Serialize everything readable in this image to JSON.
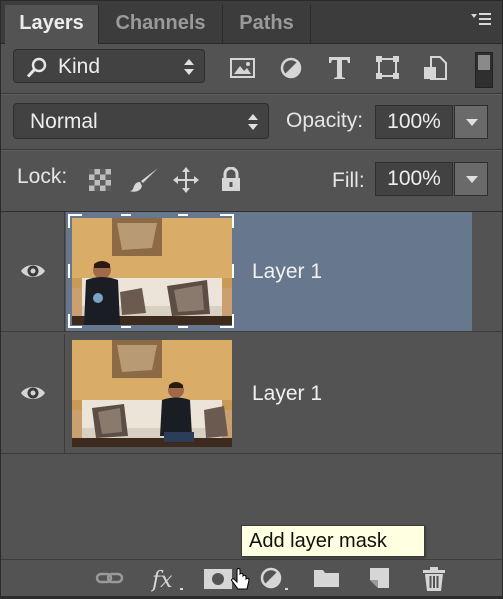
{
  "tabs": [
    {
      "label": "Layers",
      "active": true
    },
    {
      "label": "Channels",
      "active": false
    },
    {
      "label": "Paths",
      "active": false
    }
  ],
  "filter": {
    "kind_label": "Kind",
    "filter_icons": [
      "image-filter-icon",
      "adjustment-filter-icon",
      "type-filter-icon",
      "shape-filter-icon",
      "smart-object-filter-icon"
    ]
  },
  "blend": {
    "mode": "Normal",
    "opacity_label": "Opacity:",
    "opacity_value": "100%"
  },
  "lock": {
    "label": "Lock:",
    "icons": [
      "lock-transparent-pixels-icon",
      "lock-image-pixels-icon",
      "lock-position-icon",
      "lock-all-icon"
    ],
    "fill_label": "Fill:",
    "fill_value": "100%"
  },
  "layers": [
    {
      "name": "Layer 1",
      "visible": true,
      "selected": true
    },
    {
      "name": "Layer 1",
      "visible": true,
      "selected": false
    }
  ],
  "tooltip": {
    "text": "Add layer mask"
  },
  "bottom_bar": {
    "icons": [
      "link-layers-icon",
      "fx-icon",
      "add-layer-mask-icon",
      "adjustment-layer-icon",
      "new-group-icon",
      "new-layer-icon",
      "delete-layer-icon"
    ]
  },
  "colors": {
    "panel_bg": "#535353",
    "selected_row": "#67778e",
    "tooltip_bg": "#ffffe1"
  }
}
